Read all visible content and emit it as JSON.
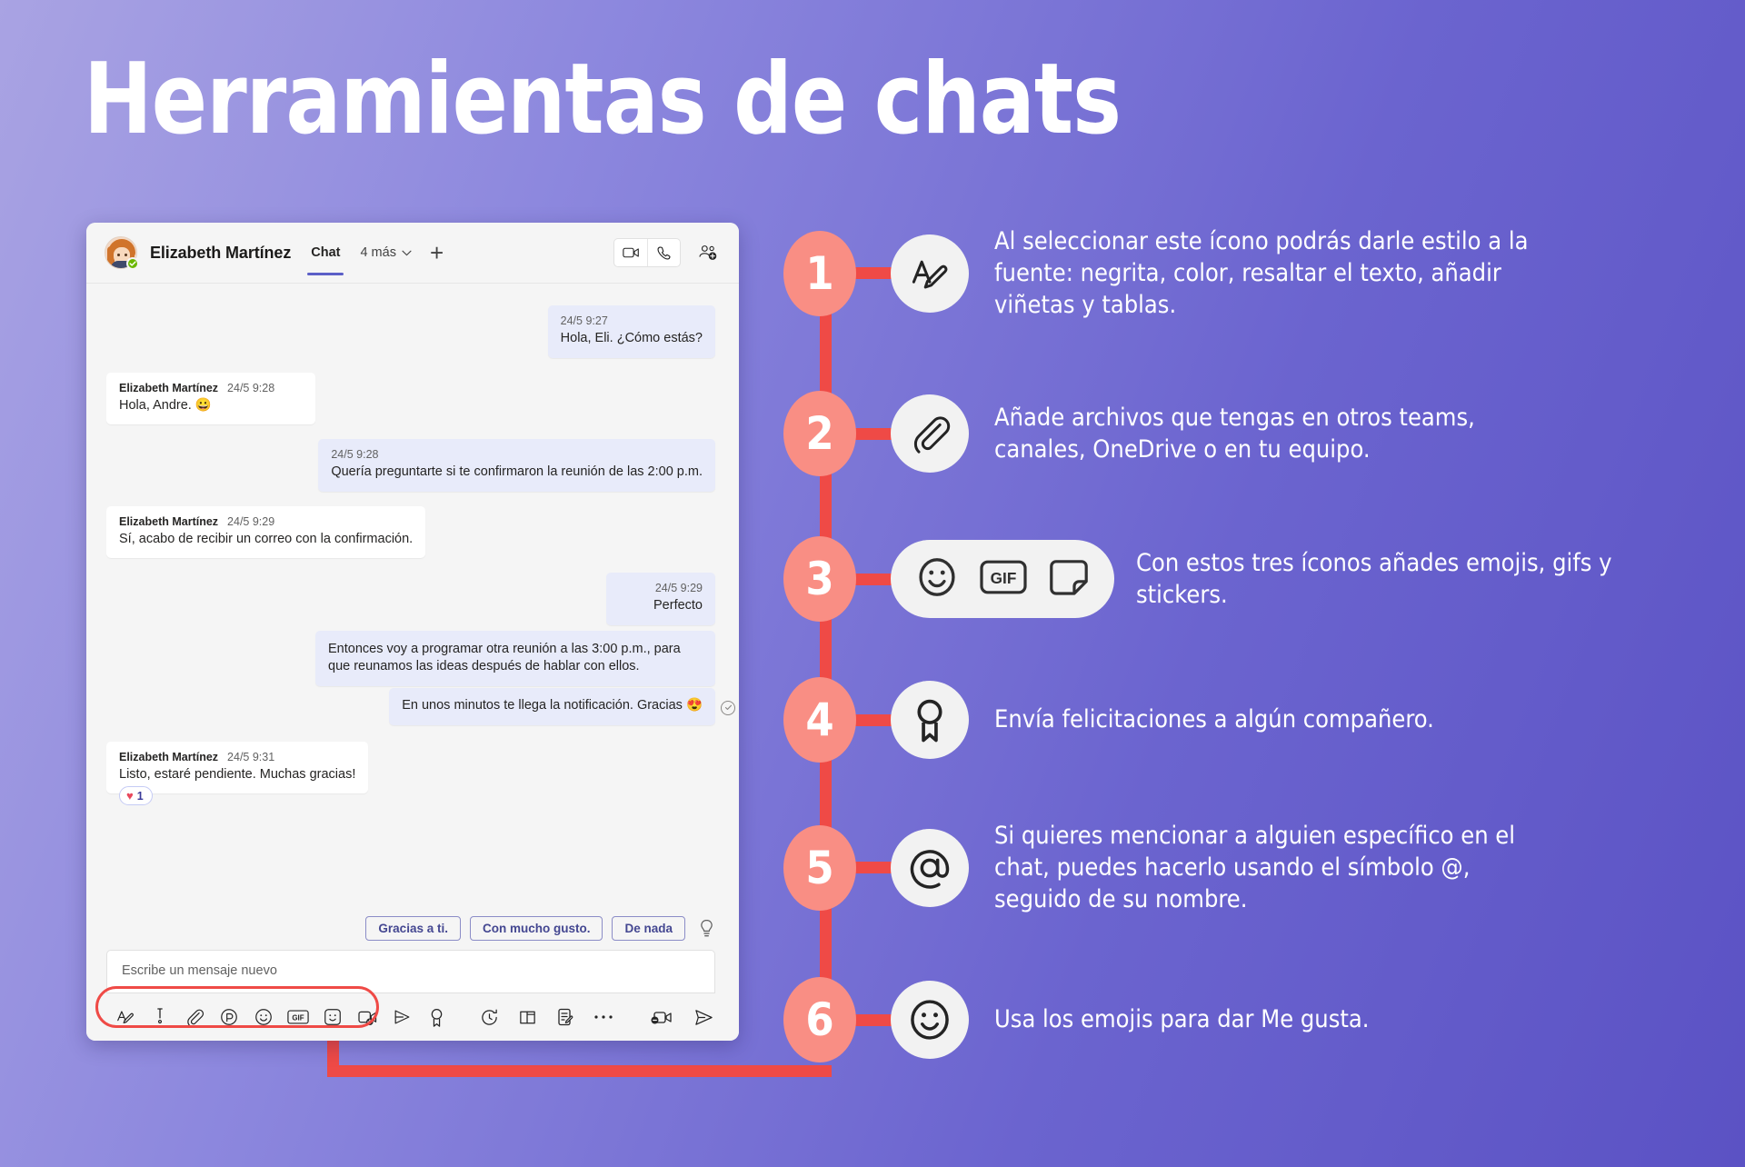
{
  "title": "Herramientas de chats",
  "colors": {
    "accent_red": "#ef4a46",
    "number_bubble": "#f98e84",
    "bg_gradient_start": "#a9a3e3",
    "bg_gradient_end": "#5b52c4",
    "teams_purple": "#5b5fc7"
  },
  "teams": {
    "header": {
      "contact_name": "Elizabeth Martínez",
      "tab_chat": "Chat",
      "tab_more": "4 más",
      "add_tab": "+",
      "video_icon": "video-camera-icon",
      "call_icon": "phone-icon",
      "add_people_icon": "add-people-icon"
    },
    "messages": [
      {
        "side": "out",
        "time": "24/5 9:27",
        "text": "Hola, Eli. ¿Cómo estás?"
      },
      {
        "side": "in",
        "author": "Elizabeth Martínez",
        "time": "24/5 9:28",
        "text": "Hola, Andre. 😀"
      },
      {
        "side": "out",
        "time": "24/5 9:28",
        "text": "Quería preguntarte si te confirmaron la reunión de las 2:00 p.m."
      },
      {
        "side": "in",
        "author": "Elizabeth Martínez",
        "time": "24/5 9:29",
        "text": "Sí, acabo de recibir un correo con la confirmación."
      },
      {
        "side": "out",
        "time": "24/5 9:29",
        "text": "Perfecto"
      },
      {
        "side": "out",
        "text": "Entonces voy a programar otra reunión a las 3:00 p.m., para que reunamos las ideas después de hablar con ellos."
      },
      {
        "side": "out",
        "text": "En unos minutos te llega la notificación. Gracias 😍",
        "seen": true
      },
      {
        "side": "in",
        "author": "Elizabeth Martínez",
        "time": "24/5 9:31",
        "text": "Listo, estaré pendiente. Muchas gracias!",
        "reaction": {
          "emoji": "♥",
          "count": "1"
        }
      }
    ],
    "suggestions": [
      "Gracias a ti.",
      "Con mucho gusto.",
      "De nada"
    ],
    "suggestion_bulb_icon": "lightbulb-icon",
    "composer": {
      "placeholder": "Escribe un mensaje nuevo",
      "value": ""
    },
    "toolbar_left": [
      "format-text-icon",
      "priority-icon",
      "attach-icon",
      "loop-icon",
      "emoji-icon",
      "gif-icon",
      "sticker-icon",
      "meet-now-icon",
      "stream-icon",
      "praise-icon"
    ],
    "toolbar_extra": [
      "schedule-icon",
      "approvals-icon",
      "forms-icon",
      "more-options-icon"
    ],
    "toolbar_right": [
      "video-message-icon",
      "send-icon"
    ]
  },
  "steps": [
    {
      "number": "1",
      "icon": "format-text-icon",
      "text": "Al seleccionar este ícono podrás darle estilo a la fuente: negrita, color, resaltar el texto, añadir viñetas y tablas."
    },
    {
      "number": "2",
      "icon": "attach-icon",
      "text": "Añade archivos que tengas en otros teams, canales, OneDrive o en tu equipo."
    },
    {
      "number": "3",
      "icon": "emoji-gif-sticker-group",
      "icons": [
        "emoji-icon",
        "gif-icon",
        "sticker-icon"
      ],
      "text": "Con estos tres íconos añades emojis, gifs y stickers."
    },
    {
      "number": "4",
      "icon": "praise-icon",
      "text": "Envía felicitaciones a algún compañero."
    },
    {
      "number": "5",
      "icon": "mention-at-icon",
      "text": "Si quieres mencionar a alguien específico en el chat, puedes hacerlo usando el símbolo @, seguido de su nombre."
    },
    {
      "number": "6",
      "icon": "emoji-icon",
      "text": "Usa los emojis para dar Me gusta."
    }
  ]
}
